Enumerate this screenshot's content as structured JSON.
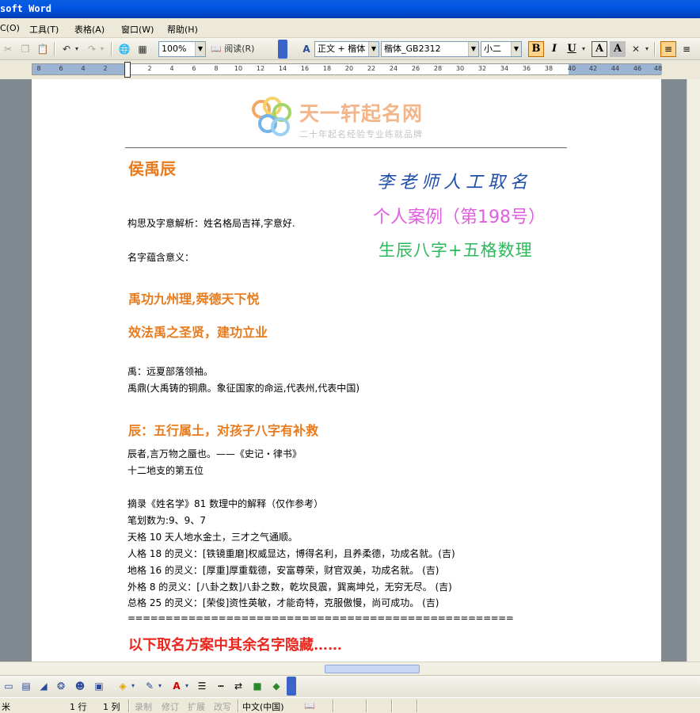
{
  "window": {
    "title": "soft Word"
  },
  "menu": [
    {
      "label": "C(O)"
    },
    {
      "label": "工具(T)"
    },
    {
      "label": "表格(A)"
    },
    {
      "label": "窗口(W)"
    },
    {
      "label": "帮助(H)"
    }
  ],
  "toolbar": {
    "zoom": "100%",
    "read_label": "阅读(R)",
    "style": "正文 + 楷体",
    "font": "楷体_GB2312",
    "size": "小二",
    "bold": "B",
    "italic": "I",
    "underline": "U",
    "font_color": "A",
    "char_shading": "A"
  },
  "ruler": {
    "ticks": [
      "8",
      "6",
      "4",
      "2",
      "2",
      "4",
      "6",
      "8",
      "10",
      "12",
      "14",
      "16",
      "18",
      "20",
      "22",
      "24",
      "26",
      "28",
      "30",
      "32",
      "34",
      "36",
      "38",
      "40",
      "42",
      "44",
      "46",
      "48"
    ]
  },
  "doc": {
    "logo_title": "天一轩起名网",
    "logo_sub": "二十年起名经验专业练就品牌",
    "name": "侯禹辰",
    "handwriting": "李老师人工取名",
    "case_no": "个人案例（第198号）",
    "bazi": "生辰八字+五格数理",
    "analysis": "构思及字意解析：姓名格局吉祥,字意好.",
    "meaning_label": "名字蕴含意义：",
    "poem1": "禹功九州理,舜德天下悦",
    "poem2": "效法禹之圣贤，建功立业",
    "yu1": "禹：远夏部落领袖。",
    "yu2": "禹鼎(大禹铸的铜鼎。象征国家的命运,代表州,代表中国)",
    "chen_head": "辰：五行属土，对孩子八字有补救",
    "chen1": "辰者,言万物之蜃也。——《史记・律书》",
    "chen2": "十二地支的第五位",
    "excerpt": "摘录《姓名学》81 数理中的解释（仅作参考）",
    "strokes": "笔划数为:9、9、7",
    "tiange": "天格 10 天人地水金土，三才之气通顺。",
    "renge": "人格 18 的灵义：[铁镜重磨]权威显达，博得名利，且养柔德，功成名就。(吉)",
    "dige": "地格 16 的灵义：[厚重]厚重载德，安富尊荣，财官双美，功成名就。 (吉)",
    "waige": "外格 8 的灵义：[八卦之数]八卦之数，乾坎艮震，巽离坤兑，无穷无尽。 (吉)",
    "zongge": "总格 25 的灵义：[荣俊]资性英敏，才能奇特，克服傲慢，尚可成功。 (吉)",
    "divider": "===================================================",
    "hidden_note": "以下取名方案中其余名字隐藏……"
  },
  "status": {
    "unit": "米",
    "line": "1 行",
    "col": "1 列",
    "rec": "录制",
    "trk": "修订",
    "ext": "扩展",
    "ovr": "改写",
    "lang": "中文(中国)"
  },
  "colors": {
    "orange_heading": "#e87b1e",
    "hand_blue": "#1f4ea8",
    "case_pink": "#e05ee0",
    "bazi_green": "#2eb85c",
    "red_note": "#e8271e"
  }
}
